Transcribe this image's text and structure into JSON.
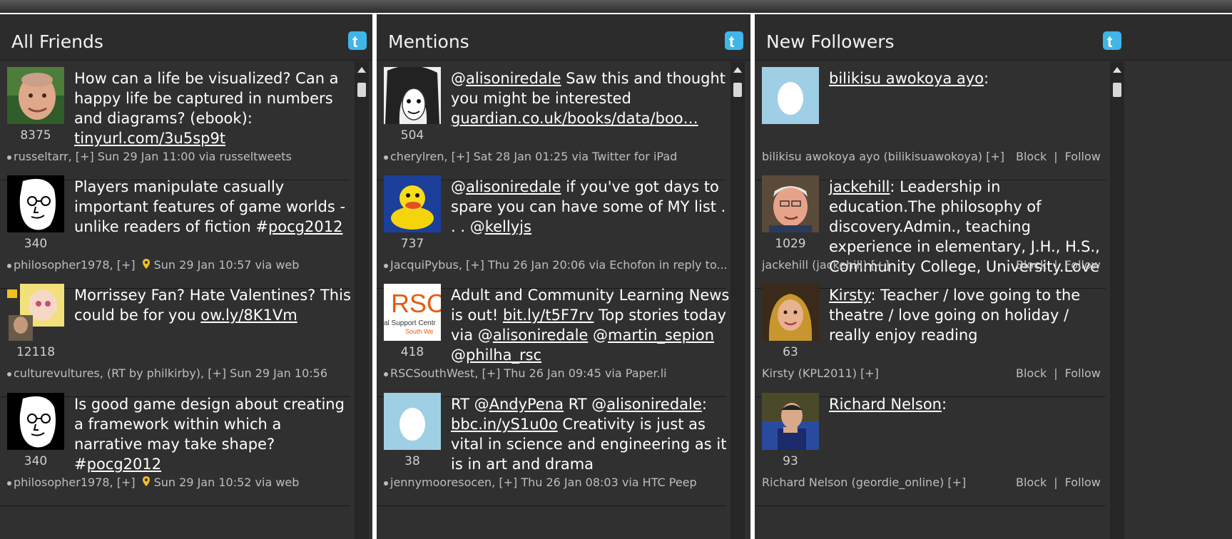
{
  "columns": [
    {
      "title": "All Friends",
      "entries": [
        {
          "avatar": "man-bald-photo",
          "text_parts": [
            {
              "t": "How can a life be visualized? Can a happy life be captured in numbers and diagrams? (ebook): "
            },
            {
              "t": "tinyurl.com/3u5sp9t",
              "link": true
            }
          ],
          "count": "8375",
          "meta": "russeltarr, [+] Sun 29 Jan 11:00 via russeltweets"
        },
        {
          "avatar": "sketch-face",
          "text_parts": [
            {
              "t": "Players manipulate casually important features of game worlds - unlike readers of fiction #"
            },
            {
              "t": "pocg2012",
              "link": true
            }
          ],
          "count": "340",
          "meta_before": "philosopher1978, [+]",
          "meta_after": "Sun 29 Jan 10:57 via web",
          "has_pin": true
        },
        {
          "avatar": "cartoon-retweet",
          "text_parts": [
            {
              "t": "Morrissey Fan? Hate Valentines? This could be for you "
            },
            {
              "t": "ow.ly/8K1Vm",
              "link": true
            }
          ],
          "count": "12118",
          "meta": "culturevultures, (RT by philkirby), [+] Sun 29 Jan 10:56"
        },
        {
          "avatar": "sketch-face",
          "text_parts": [
            {
              "t": "Is good game design about creating a framework within which a narrative may take shape? #"
            },
            {
              "t": "pocg2012",
              "link": true
            }
          ],
          "count": "340",
          "meta_before": "philosopher1978, [+]",
          "meta_after": "Sun 29 Jan 10:52 via web",
          "has_pin": true
        }
      ]
    },
    {
      "title": "Mentions",
      "entries": [
        {
          "avatar": "sketch-woman",
          "text_parts": [
            {
              "t": "@"
            },
            {
              "t": "alisoniredale",
              "link": true
            },
            {
              "t": " Saw this and thought you might be interested "
            },
            {
              "t": "guardian.co.uk/books/data/boo…",
              "link": true
            }
          ],
          "count": "504",
          "meta": "cherylren, [+] Sat 28 Jan 01:25 via Twitter for iPad"
        },
        {
          "avatar": "rubber-duck",
          "text_parts": [
            {
              "t": "@"
            },
            {
              "t": "alisoniredale",
              "link": true
            },
            {
              "t": " if you've got days to spare you can have some of MY list . . . @"
            },
            {
              "t": "kellyjs",
              "link": true
            }
          ],
          "count": "737",
          "meta": "JacquiPybus, [+] Thu 26 Jan 20:06 via Echofon in reply to..."
        },
        {
          "avatar": "rsc-logo",
          "avatar_text": "RSC",
          "avatar_subtext": "al Support Centr",
          "avatar_subtext2": "South We",
          "text_parts": [
            {
              "t": "Adult and Community Learning News is out! "
            },
            {
              "t": "bit.ly/t5F7rv",
              "link": true
            },
            {
              "t": "  Top stories today via @"
            },
            {
              "t": "alisoniredale",
              "link": true
            },
            {
              "t": " @"
            },
            {
              "t": "martin_sepion",
              "link": true
            },
            {
              "t": " @"
            },
            {
              "t": "philha_rsc",
              "link": true
            }
          ],
          "count": "418",
          "meta": "RSCSouthWest, [+] Thu 26 Jan 09:45 via Paper.li"
        },
        {
          "avatar": "egg",
          "text_parts": [
            {
              "t": "RT @"
            },
            {
              "t": "AndyPena",
              "link": true
            },
            {
              "t": " RT @"
            },
            {
              "t": "alisoniredale",
              "link": true
            },
            {
              "t": ": "
            },
            {
              "t": "bbc.in/yS1u0o",
              "link": true
            },
            {
              "t": " Creativity is just as vital in science and engineering as it is in art and drama"
            }
          ],
          "count": "38",
          "meta": "jennymooresocen, [+] Thu 26 Jan 08:03 via  HTC Peep"
        }
      ]
    },
    {
      "title": "New Followers",
      "entries": [
        {
          "avatar": "egg",
          "text_parts": [
            {
              "t": "bilikisu awokoya ayo",
              "link": true
            },
            {
              "t": ":"
            }
          ],
          "count": "",
          "meta": "bilikisu awokoya ayo (bilikisuawokoya)  [+]",
          "block": "Block",
          "sep": "|",
          "follow": "Follow"
        },
        {
          "avatar": "man-white-hair",
          "text_parts": [
            {
              "t": "jackehill",
              "link": true
            },
            {
              "t": ": Leadership in education.The philosophy of discovery.Admin., teaching experience in elementary, J.H., H.S., Community College, University.Love"
            }
          ],
          "count": "1029",
          "meta": "jackehill (jackehill)  [+]",
          "block": "Block",
          "sep": "|",
          "follow": "Follow"
        },
        {
          "avatar": "woman-blonde",
          "text_parts": [
            {
              "t": "Kirsty",
              "link": true
            },
            {
              "t": ": Teacher / love going to the theatre / love going on holiday / really enjoy reading"
            }
          ],
          "count": "63",
          "meta": "Kirsty (KPL2011)  [+]",
          "block": "Block",
          "sep": "|",
          "follow": "Follow"
        },
        {
          "avatar": "man-bluebg",
          "text_parts": [
            {
              "t": "Richard Nelson",
              "link": true
            },
            {
              "t": ":"
            }
          ],
          "count": "93",
          "meta": "Richard Nelson (geordie_online)  [+]",
          "block": "Block",
          "sep": "|",
          "follow": "Follow"
        }
      ]
    }
  ],
  "colors": {
    "column_bg": "#303030",
    "header_bg": "#2c2c2c",
    "twitter_blue": "#3fb5e8",
    "egg_bg": "#9ecfe4"
  }
}
